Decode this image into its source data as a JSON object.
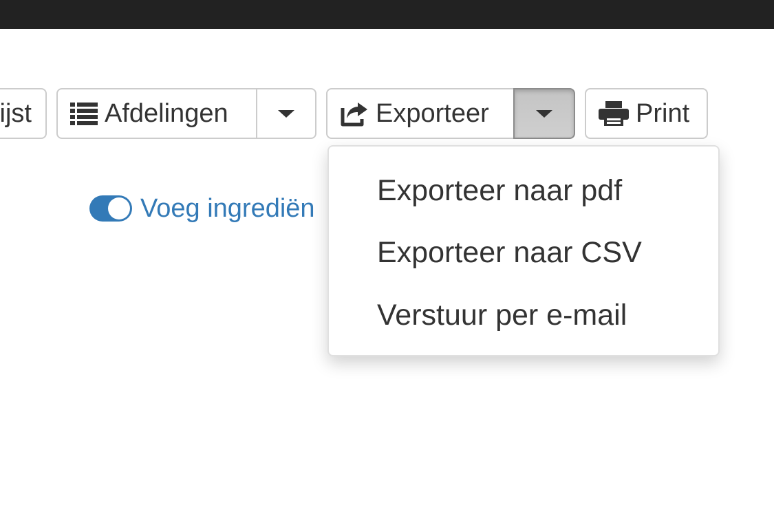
{
  "toolbar": {
    "list_label_partial": "ijst",
    "departments_label": "Afdelingen",
    "export_label": "Exporteer",
    "print_label": "Print"
  },
  "icons": {
    "list": "list-icon",
    "export": "share-export-icon",
    "print": "print-icon",
    "caret": "caret-down-icon"
  },
  "toggle": {
    "label": "Voeg ingrediën",
    "state": "on",
    "color": "#337ab7"
  },
  "export_menu": {
    "items": [
      "Exporteer naar pdf",
      "Exporteer naar CSV",
      "Verstuur per e-mail"
    ]
  }
}
